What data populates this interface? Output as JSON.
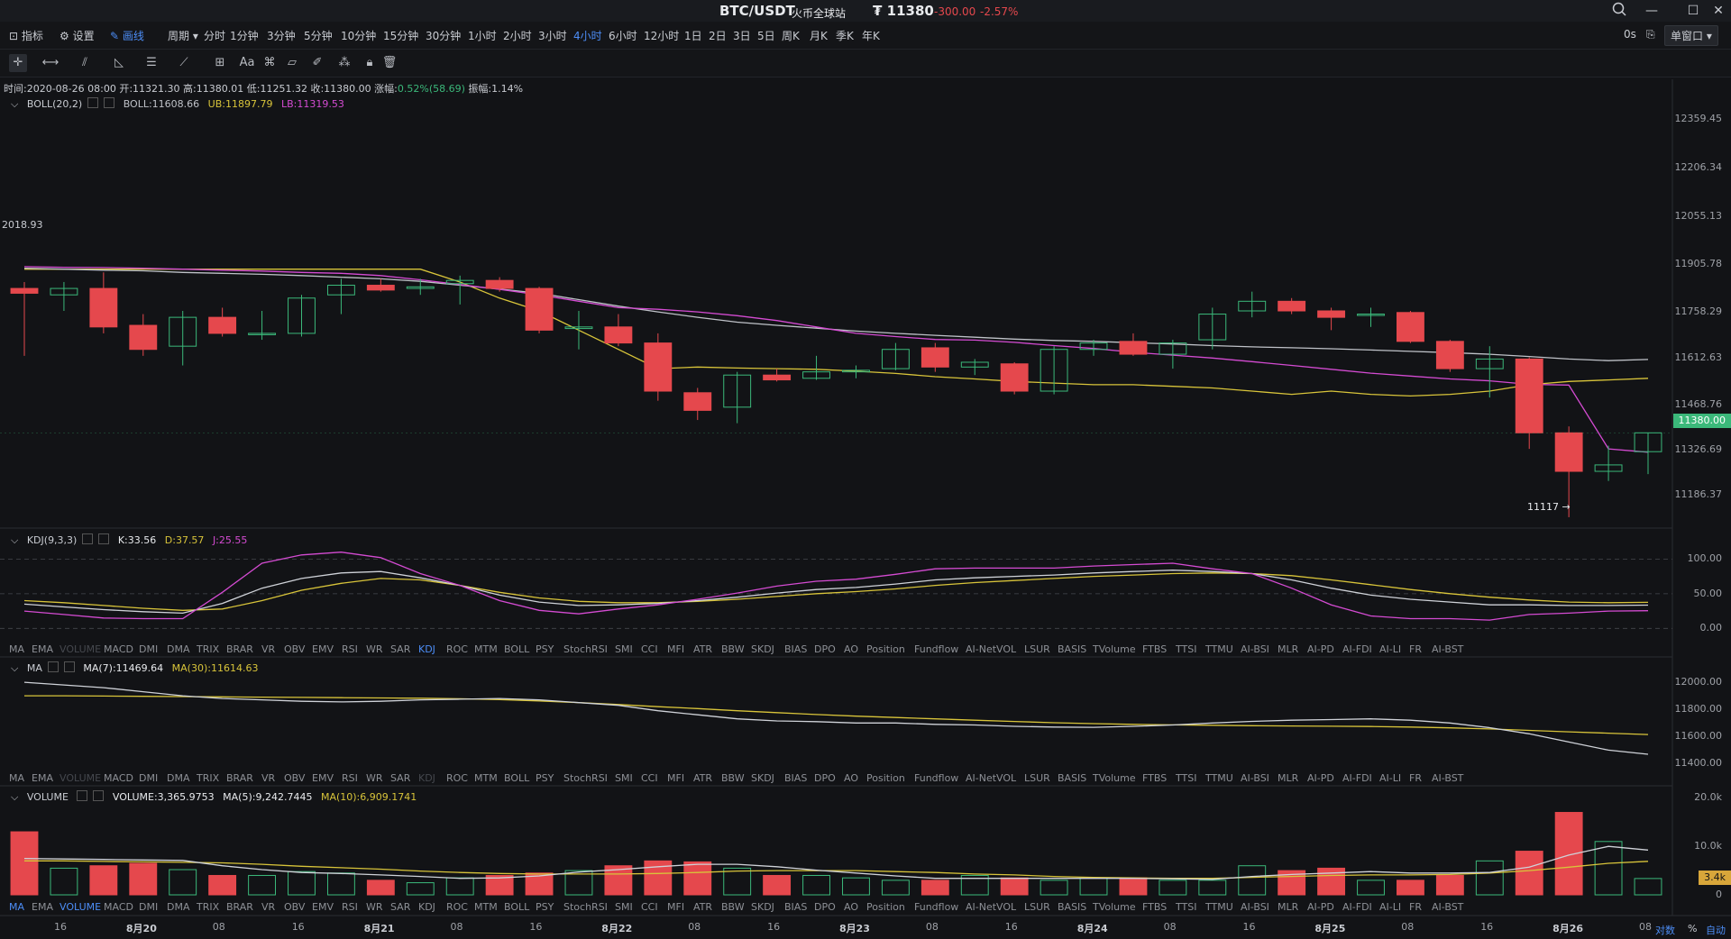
{
  "title": {
    "pair": "BTC/USDT",
    "exchange": "火币全球站",
    "price": "₮ 11380",
    "change": "-300.00",
    "change_pct": "-2.57%"
  },
  "window_controls": [
    "search-icon",
    "minimize-icon",
    "maximize-icon",
    "close-icon"
  ],
  "menu": {
    "left": [
      {
        "label": "指标",
        "icon": "indicator-icon"
      },
      {
        "label": "设置",
        "icon": "gear-icon"
      },
      {
        "label": "画线",
        "icon": "pen-icon",
        "active": true
      }
    ],
    "period_label": "周期",
    "periods": [
      "分时",
      "1分钟",
      "3分钟",
      "5分钟",
      "10分钟",
      "15分钟",
      "30分钟",
      "1小时",
      "2小时",
      "3小时",
      "4小时",
      "6小时",
      "12小时",
      "1日",
      "2日",
      "3日",
      "5日",
      "周K",
      "月K",
      "季K",
      "年K"
    ],
    "active_period": "4小时",
    "countdown": "0s",
    "window_mode": "单窗口"
  },
  "draw_tools": [
    "crosshair-icon",
    "horizontal-line-icon",
    "parallel-channel-icon",
    "angle-icon",
    "fib-icon",
    "trend-icon",
    "rect-icon",
    "text-icon",
    "magnet-icon",
    "ruler-icon",
    "brush-icon",
    "pattern-icon",
    "lock-icon",
    "trash-icon"
  ],
  "text_tool": "Aa",
  "ohlc": {
    "time": "时间:2020-08-26 08:00",
    "open": "开:11321.30",
    "high": "高:11380.01",
    "low": "低:11251.32",
    "close": "收:11380.00",
    "change_label": "涨幅:",
    "change_val": "0.52%(58.69)",
    "amp": "振幅:1.14%"
  },
  "boll": {
    "name": "BOLL(20,2)",
    "mid": "BOLL:11608.66",
    "ub": "UB:11897.79",
    "lb": "LB:11319.53",
    "left_value": "2018.93",
    "low_marker": "11117 →"
  },
  "kdj": {
    "name": "KDJ(9,3,3)",
    "k": "K:33.56",
    "d": "D:37.57",
    "j": "J:25.55"
  },
  "ma": {
    "name": "MA",
    "ma7": "MA(7):11469.64",
    "ma30": "MA(30):11614.63"
  },
  "volume": {
    "name": "VOLUME",
    "vol": "VOLUME:3,365.9753",
    "ma5": "MA(5):9,242.7445",
    "ma10": "MA(10):6,909.1741",
    "tag": "3.4k"
  },
  "indicator_tabs": [
    "MA",
    "EMA",
    "VOLUME",
    "MACD",
    "DMI",
    "DMA",
    "TRIX",
    "BRAR",
    "VR",
    "OBV",
    "EMV",
    "RSI",
    "WR",
    "SAR",
    "KDJ",
    "ROC",
    "MTM",
    "BOLL",
    "PSY",
    "StochRSI",
    "SMI",
    "CCI",
    "MFI",
    "ATR",
    "BBW",
    "SKDJ",
    "BIAS",
    "DPO",
    "AO",
    "Position",
    "Fundflow",
    "AI-NetVOL",
    "LSUR",
    "BASIS",
    "TVolume",
    "FTBS",
    "TTSI",
    "TTMU",
    "AI-BSI",
    "MLR",
    "AI-PD",
    "AI-FDI",
    "AI-LI",
    "FR",
    "AI-BST"
  ],
  "price_axis": [
    "12359.45",
    "12206.34",
    "12055.13",
    "11905.78",
    "11758.29",
    "11612.63",
    "11468.76",
    "11326.69",
    "11186.37"
  ],
  "current_price_tag": "11380.00",
  "kdj_axis": [
    "100.00",
    "50.00",
    "0.00"
  ],
  "ma_axis": [
    "12000.00",
    "11800.00",
    "11600.00",
    "11400.00"
  ],
  "vol_axis": [
    "20.0k",
    "10.0k",
    "0"
  ],
  "time_axis": [
    {
      "t": "16",
      "b": false
    },
    {
      "t": "8月20",
      "b": true
    },
    {
      "t": "08",
      "b": false
    },
    {
      "t": "16",
      "b": false
    },
    {
      "t": "8月21",
      "b": true
    },
    {
      "t": "08",
      "b": false
    },
    {
      "t": "16",
      "b": false
    },
    {
      "t": "8月22",
      "b": true
    },
    {
      "t": "08",
      "b": false
    },
    {
      "t": "16",
      "b": false
    },
    {
      "t": "8月23",
      "b": true
    },
    {
      "t": "08",
      "b": false
    },
    {
      "t": "16",
      "b": false
    },
    {
      "t": "8月24",
      "b": true
    },
    {
      "t": "08",
      "b": false
    },
    {
      "t": "16",
      "b": false
    },
    {
      "t": "8月25",
      "b": true
    },
    {
      "t": "08",
      "b": false
    },
    {
      "t": "16",
      "b": false
    },
    {
      "t": "8月26",
      "b": true
    },
    {
      "t": "08",
      "b": false
    }
  ],
  "scale_buttons": {
    "log": "对数",
    "pct": "%",
    "auto": "自动"
  },
  "colors": {
    "up": "#3bb87a",
    "down": "#e5484d",
    "ub": "#d8c43a",
    "mid": "#bfc2c8",
    "lb": "#d44bd2",
    "accent": "#4c8df6",
    "bg": "#121316"
  },
  "chart_data": {
    "type": "candlestick",
    "candles": [
      {
        "o": 11830,
        "c": 11815,
        "h": 11850,
        "l": 11620
      },
      {
        "o": 11810,
        "c": 11830,
        "h": 11850,
        "l": 11760
      },
      {
        "o": 11830,
        "c": 11710,
        "h": 11880,
        "l": 11690
      },
      {
        "o": 11715,
        "c": 11640,
        "h": 11750,
        "l": 11620
      },
      {
        "o": 11650,
        "c": 11740,
        "h": 11760,
        "l": 11590
      },
      {
        "o": 11740,
        "c": 11690,
        "h": 11770,
        "l": 11680
      },
      {
        "o": 11690,
        "c": 11690,
        "h": 11760,
        "l": 11670
      },
      {
        "o": 11690,
        "c": 11800,
        "h": 11810,
        "l": 11680
      },
      {
        "o": 11810,
        "c": 11840,
        "h": 11860,
        "l": 11750
      },
      {
        "o": 11840,
        "c": 11825,
        "h": 11860,
        "l": 11820
      },
      {
        "o": 11830,
        "c": 11835,
        "h": 11860,
        "l": 11810
      },
      {
        "o": 11845,
        "c": 11855,
        "h": 11870,
        "l": 11780
      },
      {
        "o": 11855,
        "c": 11830,
        "h": 11865,
        "l": 11820
      },
      {
        "o": 11830,
        "c": 11700,
        "h": 11835,
        "l": 11690
      },
      {
        "o": 11705,
        "c": 11710,
        "h": 11760,
        "l": 11640
      },
      {
        "o": 11710,
        "c": 11660,
        "h": 11750,
        "l": 11650
      },
      {
        "o": 11660,
        "c": 11510,
        "h": 11690,
        "l": 11480
      },
      {
        "o": 11505,
        "c": 11450,
        "h": 11520,
        "l": 11420
      },
      {
        "o": 11460,
        "c": 11560,
        "h": 11570,
        "l": 11410
      },
      {
        "o": 11560,
        "c": 11545,
        "h": 11580,
        "l": 11540
      },
      {
        "o": 11550,
        "c": 11570,
        "h": 11620,
        "l": 11545
      },
      {
        "o": 11570,
        "c": 11575,
        "h": 11590,
        "l": 11550
      },
      {
        "o": 11580,
        "c": 11640,
        "h": 11660,
        "l": 11575
      },
      {
        "o": 11645,
        "c": 11585,
        "h": 11660,
        "l": 11570
      },
      {
        "o": 11585,
        "c": 11600,
        "h": 11610,
        "l": 11560
      },
      {
        "o": 11595,
        "c": 11510,
        "h": 11600,
        "l": 11500
      },
      {
        "o": 11510,
        "c": 11640,
        "h": 11650,
        "l": 11500
      },
      {
        "o": 11640,
        "c": 11660,
        "h": 11670,
        "l": 11620
      },
      {
        "o": 11665,
        "c": 11625,
        "h": 11690,
        "l": 11620
      },
      {
        "o": 11625,
        "c": 11660,
        "h": 11670,
        "l": 11580
      },
      {
        "o": 11670,
        "c": 11750,
        "h": 11770,
        "l": 11640
      },
      {
        "o": 11760,
        "c": 11790,
        "h": 11820,
        "l": 11740
      },
      {
        "o": 11790,
        "c": 11760,
        "h": 11800,
        "l": 11750
      },
      {
        "o": 11760,
        "c": 11740,
        "h": 11770,
        "l": 11700
      },
      {
        "o": 11750,
        "c": 11750,
        "h": 11770,
        "l": 11710
      },
      {
        "o": 11755,
        "c": 11665,
        "h": 11760,
        "l": 11660
      },
      {
        "o": 11665,
        "c": 11580,
        "h": 11670,
        "l": 11570
      },
      {
        "o": 11580,
        "c": 11610,
        "h": 11650,
        "l": 11490
      },
      {
        "o": 11610,
        "c": 11380,
        "h": 11615,
        "l": 11330
      },
      {
        "o": 11380,
        "c": 11260,
        "h": 11400,
        "l": 11117
      },
      {
        "o": 11260,
        "c": 11280,
        "h": 11340,
        "l": 11230
      },
      {
        "o": 11321.3,
        "c": 11380,
        "h": 11380.01,
        "l": 11251.32
      }
    ],
    "ub": [
      11890,
      11890,
      11890,
      11890,
      11890,
      11890,
      11890,
      11890,
      11890,
      11890,
      11890,
      11850,
      11800,
      11760,
      11700,
      11640,
      11580,
      11585,
      11582,
      11580,
      11578,
      11572,
      11565,
      11555,
      11548,
      11540,
      11535,
      11530,
      11530,
      11525,
      11520,
      11510,
      11500,
      11510,
      11500,
      11495,
      11500,
      11510,
      11530,
      11540,
      11545,
      11550
    ],
    "mid_band": [
      11893,
      11890,
      11887,
      11885,
      11880,
      11877,
      11874,
      11870,
      11865,
      11860,
      11852,
      11840,
      11828,
      11815,
      11795,
      11775,
      11757,
      11740,
      11725,
      11715,
      11706,
      11697,
      11690,
      11684,
      11678,
      11672,
      11668,
      11665,
      11661,
      11657,
      11652,
      11648,
      11645,
      11642,
      11638,
      11634,
      11630,
      11625,
      11618,
      11610,
      11605,
      11608.66
    ],
    "lb_band": [
      11897.79,
      11896,
      11895,
      11893,
      11890,
      11887,
      11884,
      11880,
      11877,
      11870,
      11857,
      11842,
      11827,
      11810,
      11790,
      11770,
      11765,
      11757,
      11745,
      11730,
      11710,
      11690,
      11680,
      11671,
      11669,
      11662,
      11652,
      11643,
      11631,
      11622,
      11613,
      11602,
      11590,
      11578,
      11566,
      11557,
      11548,
      11542,
      11531,
      11529,
      11330,
      11319.53
    ],
    "kdj_k": [
      35,
      31,
      27,
      24,
      22,
      36,
      58,
      72,
      80,
      82,
      73,
      62,
      48,
      38,
      33,
      34,
      36,
      40,
      45,
      51,
      56,
      59,
      64,
      70,
      73,
      75,
      77,
      80,
      82,
      84,
      82,
      79,
      70,
      58,
      48,
      42,
      38,
      34,
      34,
      33,
      33,
      33.56
    ],
    "kdj_d": [
      40,
      37,
      33,
      29,
      26,
      28,
      40,
      55,
      65,
      72,
      70,
      62,
      52,
      44,
      39,
      37,
      37,
      39,
      42,
      46,
      50,
      53,
      57,
      62,
      66,
      69,
      72,
      75,
      77,
      79,
      80,
      79,
      76,
      70,
      63,
      56,
      50,
      45,
      41,
      38,
      37,
      37.57
    ],
    "kdj_j": [
      25,
      20,
      15,
      14,
      14,
      52,
      94,
      106,
      110,
      102,
      79,
      62,
      40,
      26,
      21,
      28,
      34,
      42,
      51,
      61,
      68,
      71,
      78,
      86,
      87,
      87,
      87,
      90,
      92,
      94,
      86,
      79,
      58,
      34,
      18,
      14,
      14,
      12,
      20,
      22,
      25,
      25.55
    ],
    "ma7": [
      12000,
      11980,
      11960,
      11930,
      11900,
      11880,
      11870,
      11860,
      11855,
      11860,
      11870,
      11875,
      11880,
      11870,
      11850,
      11830,
      11790,
      11760,
      11730,
      11715,
      11710,
      11700,
      11700,
      11690,
      11685,
      11675,
      11670,
      11668,
      11675,
      11685,
      11700,
      11712,
      11720,
      11725,
      11730,
      11720,
      11700,
      11665,
      11620,
      11560,
      11500,
      11469.64
    ],
    "ma30": [
      11900,
      11900,
      11898,
      11896,
      11894,
      11892,
      11890,
      11888,
      11886,
      11884,
      11882,
      11878,
      11872,
      11862,
      11850,
      11836,
      11820,
      11806,
      11790,
      11776,
      11762,
      11750,
      11740,
      11730,
      11720,
      11711,
      11702,
      11695,
      11690,
      11686,
      11683,
      11680,
      11678,
      11676,
      11674,
      11670,
      11664,
      11656,
      11645,
      11635,
      11625,
      11614.63
    ],
    "volume": [
      13000,
      5500,
      6000,
      6500,
      5200,
      4000,
      4000,
      4800,
      4500,
      3000,
      2500,
      3500,
      4000,
      4500,
      5000,
      6000,
      7000,
      6800,
      5500,
      4000,
      4000,
      3500,
      3000,
      3000,
      4000,
      3500,
      3000,
      3500,
      3500,
      3000,
      3000,
      6000,
      5000,
      5500,
      3000,
      3000,
      4000,
      7000,
      9000,
      17000,
      11000,
      3365.9753
    ],
    "vol_ma5": [
      7500,
      7400,
      7300,
      7200,
      7100,
      6000,
      5200,
      4600,
      4400,
      4100,
      3800,
      3400,
      3500,
      3900,
      4700,
      5200,
      5800,
      6300,
      6300,
      5800,
      5100,
      4500,
      3900,
      3400,
      3400,
      3400,
      3400,
      3400,
      3400,
      3300,
      3200,
      3800,
      4200,
      4500,
      4800,
      4500,
      4500,
      4600,
      5700,
      8200,
      10000,
      9242.7445
    ],
    "vol_ma10": [
      7000,
      7000,
      6900,
      6800,
      6700,
      6600,
      6300,
      5900,
      5600,
      5300,
      4900,
      4600,
      4400,
      4300,
      4300,
      4300,
      4400,
      4600,
      4900,
      5000,
      5000,
      5000,
      4800,
      4600,
      4300,
      4100,
      3800,
      3600,
      3500,
      3400,
      3400,
      3600,
      3800,
      4000,
      4100,
      4100,
      4200,
      4500,
      5000,
      5700,
      6500,
      6909.1741
    ],
    "ylim_price": [
      11100,
      12420
    ],
    "ylim_kdj": [
      -10,
      120
    ],
    "ylim_ma": [
      11350,
      12080
    ],
    "ylim_vol": [
      0,
      21000
    ]
  }
}
